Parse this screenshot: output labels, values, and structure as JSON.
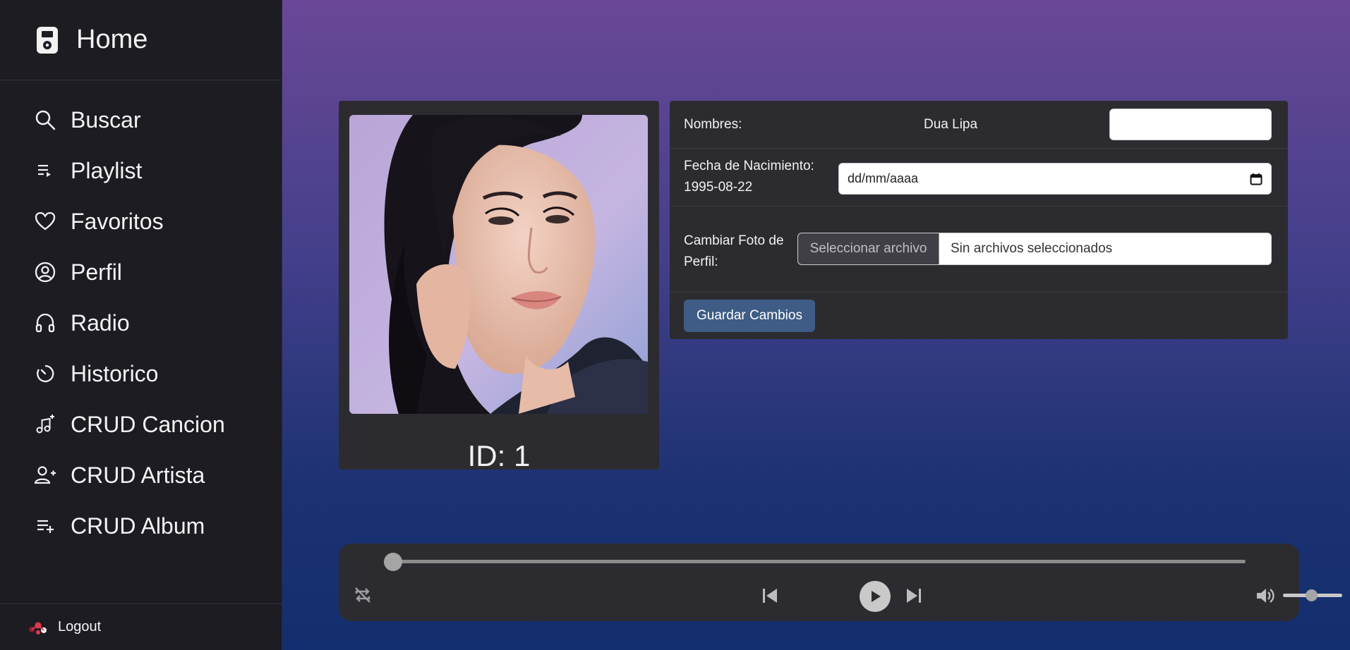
{
  "sidebar": {
    "title": "Home",
    "items": [
      {
        "label": "Buscar",
        "icon": "search-icon"
      },
      {
        "label": "Playlist",
        "icon": "playlist-icon"
      },
      {
        "label": "Favoritos",
        "icon": "heart-icon"
      },
      {
        "label": "Perfil",
        "icon": "user-circle-icon"
      },
      {
        "label": "Radio",
        "icon": "headphones-icon"
      },
      {
        "label": "Historico",
        "icon": "history-icon"
      },
      {
        "label": "CRUD Cancion",
        "icon": "music-add-icon"
      },
      {
        "label": "CRUD Artista",
        "icon": "user-add-icon"
      },
      {
        "label": "CRUD Album",
        "icon": "list-add-icon"
      }
    ],
    "logout_label": "Logout"
  },
  "profile": {
    "id_label": "ID: 1"
  },
  "form": {
    "name_label": "Nombres:",
    "name_value": "Dua Lipa",
    "name_input_value": "",
    "birth_label": "Fecha de Nacimiento:",
    "birth_value": "1995-08-22",
    "date_placeholder": "dd/mm/aaaa",
    "photo_label_line1": "Cambiar Foto de",
    "photo_label_line2": "Perfil:",
    "file_button": "Seleccionar archivo",
    "file_status": "Sin archivos seleccionados",
    "save_button": "Guardar Cambios"
  },
  "player": {
    "progress": 0,
    "volume": 0.5
  },
  "colors": {
    "sidebar_bg": "#1d1c23",
    "card_bg": "#2c2c30",
    "accent_button": "#3e5c85",
    "gradient_top": "#6a4897",
    "gradient_bottom": "#132e6e"
  }
}
